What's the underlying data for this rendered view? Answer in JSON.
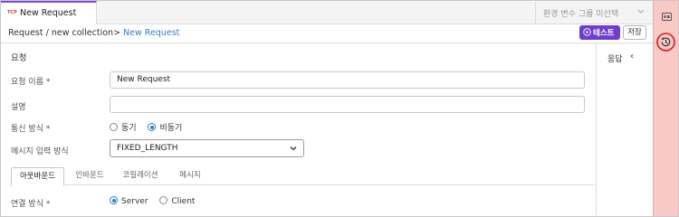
{
  "tab": {
    "badge": "TCP",
    "title": "New Request"
  },
  "env_select": {
    "placeholder": "환경 변수 그룹 미선택"
  },
  "breadcrumb": {
    "path": "Request / new collection> ",
    "current": "New Request"
  },
  "toolbar": {
    "test_label": "테스트",
    "save_label": "저장"
  },
  "section": {
    "title": "요청"
  },
  "form": {
    "name_label": "요청 이름",
    "name_value": "New Request",
    "required_mark": "*",
    "desc_label": "설명",
    "desc_value": "",
    "comm_label": "통신 방식",
    "comm_options": [
      "동기",
      "비동기"
    ],
    "comm_selected": "비동기",
    "msg_label": "메시지 입력 방식",
    "msg_value": "FIXED_LENGTH"
  },
  "subtabs": [
    "아웃바운드",
    "인바운드",
    "코릴레이션",
    "메시지"
  ],
  "subtab_active": "아웃바운드",
  "connection": {
    "label": "연결 방식",
    "options": [
      "Server",
      "Client"
    ],
    "selected": "Server"
  },
  "response": {
    "label": "응답",
    "collapse_glyph": "‹"
  },
  "colors": {
    "accent": "#6f3fc9",
    "link": "#2f7fc8",
    "strip": "#f9c9c6",
    "highlight": "#d4191f"
  },
  "icons": [
    "tcp-badge-icon",
    "chevron-down-icon",
    "play-icon",
    "chevron-left-icon",
    "variables-icon",
    "history-icon"
  ]
}
